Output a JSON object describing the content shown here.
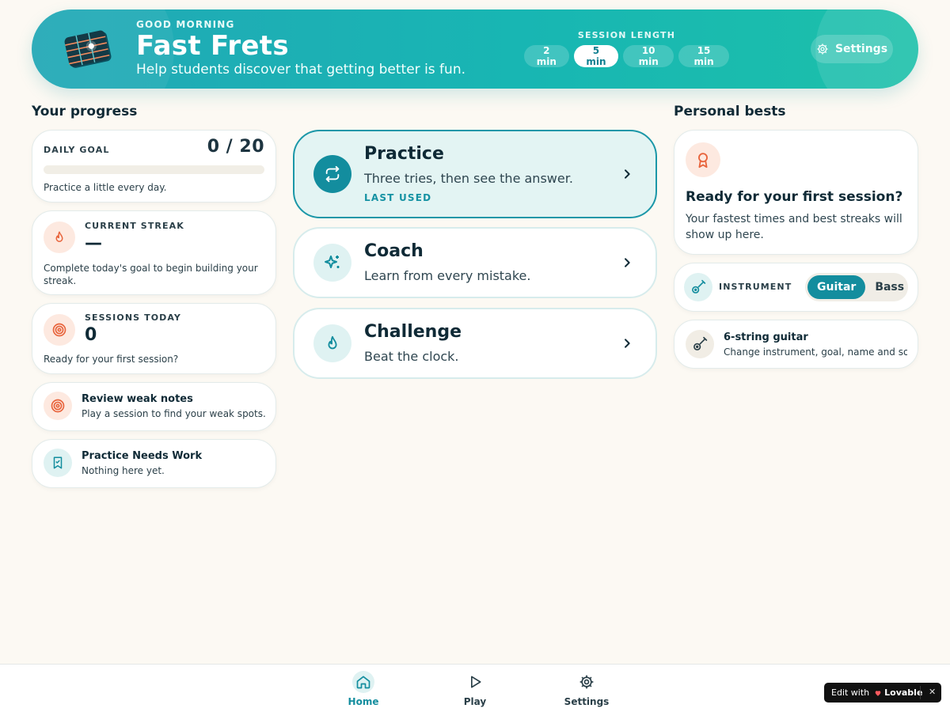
{
  "header": {
    "greeting": "GOOD MORNING",
    "title": "Fast Frets",
    "tagline": "Help students discover that getting better is fun.",
    "session_label": "SESSION LENGTH",
    "session_options": [
      "2 min",
      "5 min",
      "10 min",
      "15 min"
    ],
    "session_selected": "5 min",
    "settings_label": "Settings"
  },
  "progress": {
    "section_title": "Your progress",
    "daily_goal": {
      "label": "DAILY GOAL",
      "count": "0 / 20",
      "progress_fraction": 0,
      "caption": "Practice a little every day."
    },
    "streak": {
      "label": "CURRENT STREAK",
      "value": "—",
      "caption": "Complete today's goal to begin building your streak."
    },
    "sessions_today": {
      "label": "SESSIONS TODAY",
      "value": "0",
      "caption": "Ready for your first session?"
    },
    "weak_notes": {
      "title": "Review weak notes",
      "caption": "Play a session to find your weak spots."
    },
    "needs_work": {
      "title": "Practice Needs Work",
      "caption": "Nothing here yet."
    }
  },
  "modes": [
    {
      "title": "Practice",
      "desc": "Three tries, then see the answer.",
      "badge": "LAST USED"
    },
    {
      "title": "Coach",
      "desc": "Learn from every mistake."
    },
    {
      "title": "Challenge",
      "desc": "Beat the clock."
    }
  ],
  "bests": {
    "section_title": "Personal bests",
    "heading": "Ready for your first session?",
    "caption": "Your fastest times and best streaks will show up here."
  },
  "instrument": {
    "label": "INSTRUMENT",
    "options": [
      "Guitar",
      "Bass"
    ],
    "selected": "Guitar"
  },
  "profile": {
    "title": "6-string guitar",
    "caption": "Change instrument, goal, name and so..."
  },
  "nav": {
    "items": [
      "Home",
      "Play",
      "Settings"
    ],
    "active": "Home"
  },
  "badge": {
    "edit_with": "Edit with",
    "brand": "Lovable"
  },
  "colors": {
    "accent": "#138d9e",
    "header_gradient_start": "#22a8b6",
    "header_gradient_end": "#1cc0aa",
    "warm_icon_bg": "#fde9e0",
    "background": "#fcf9f3"
  }
}
